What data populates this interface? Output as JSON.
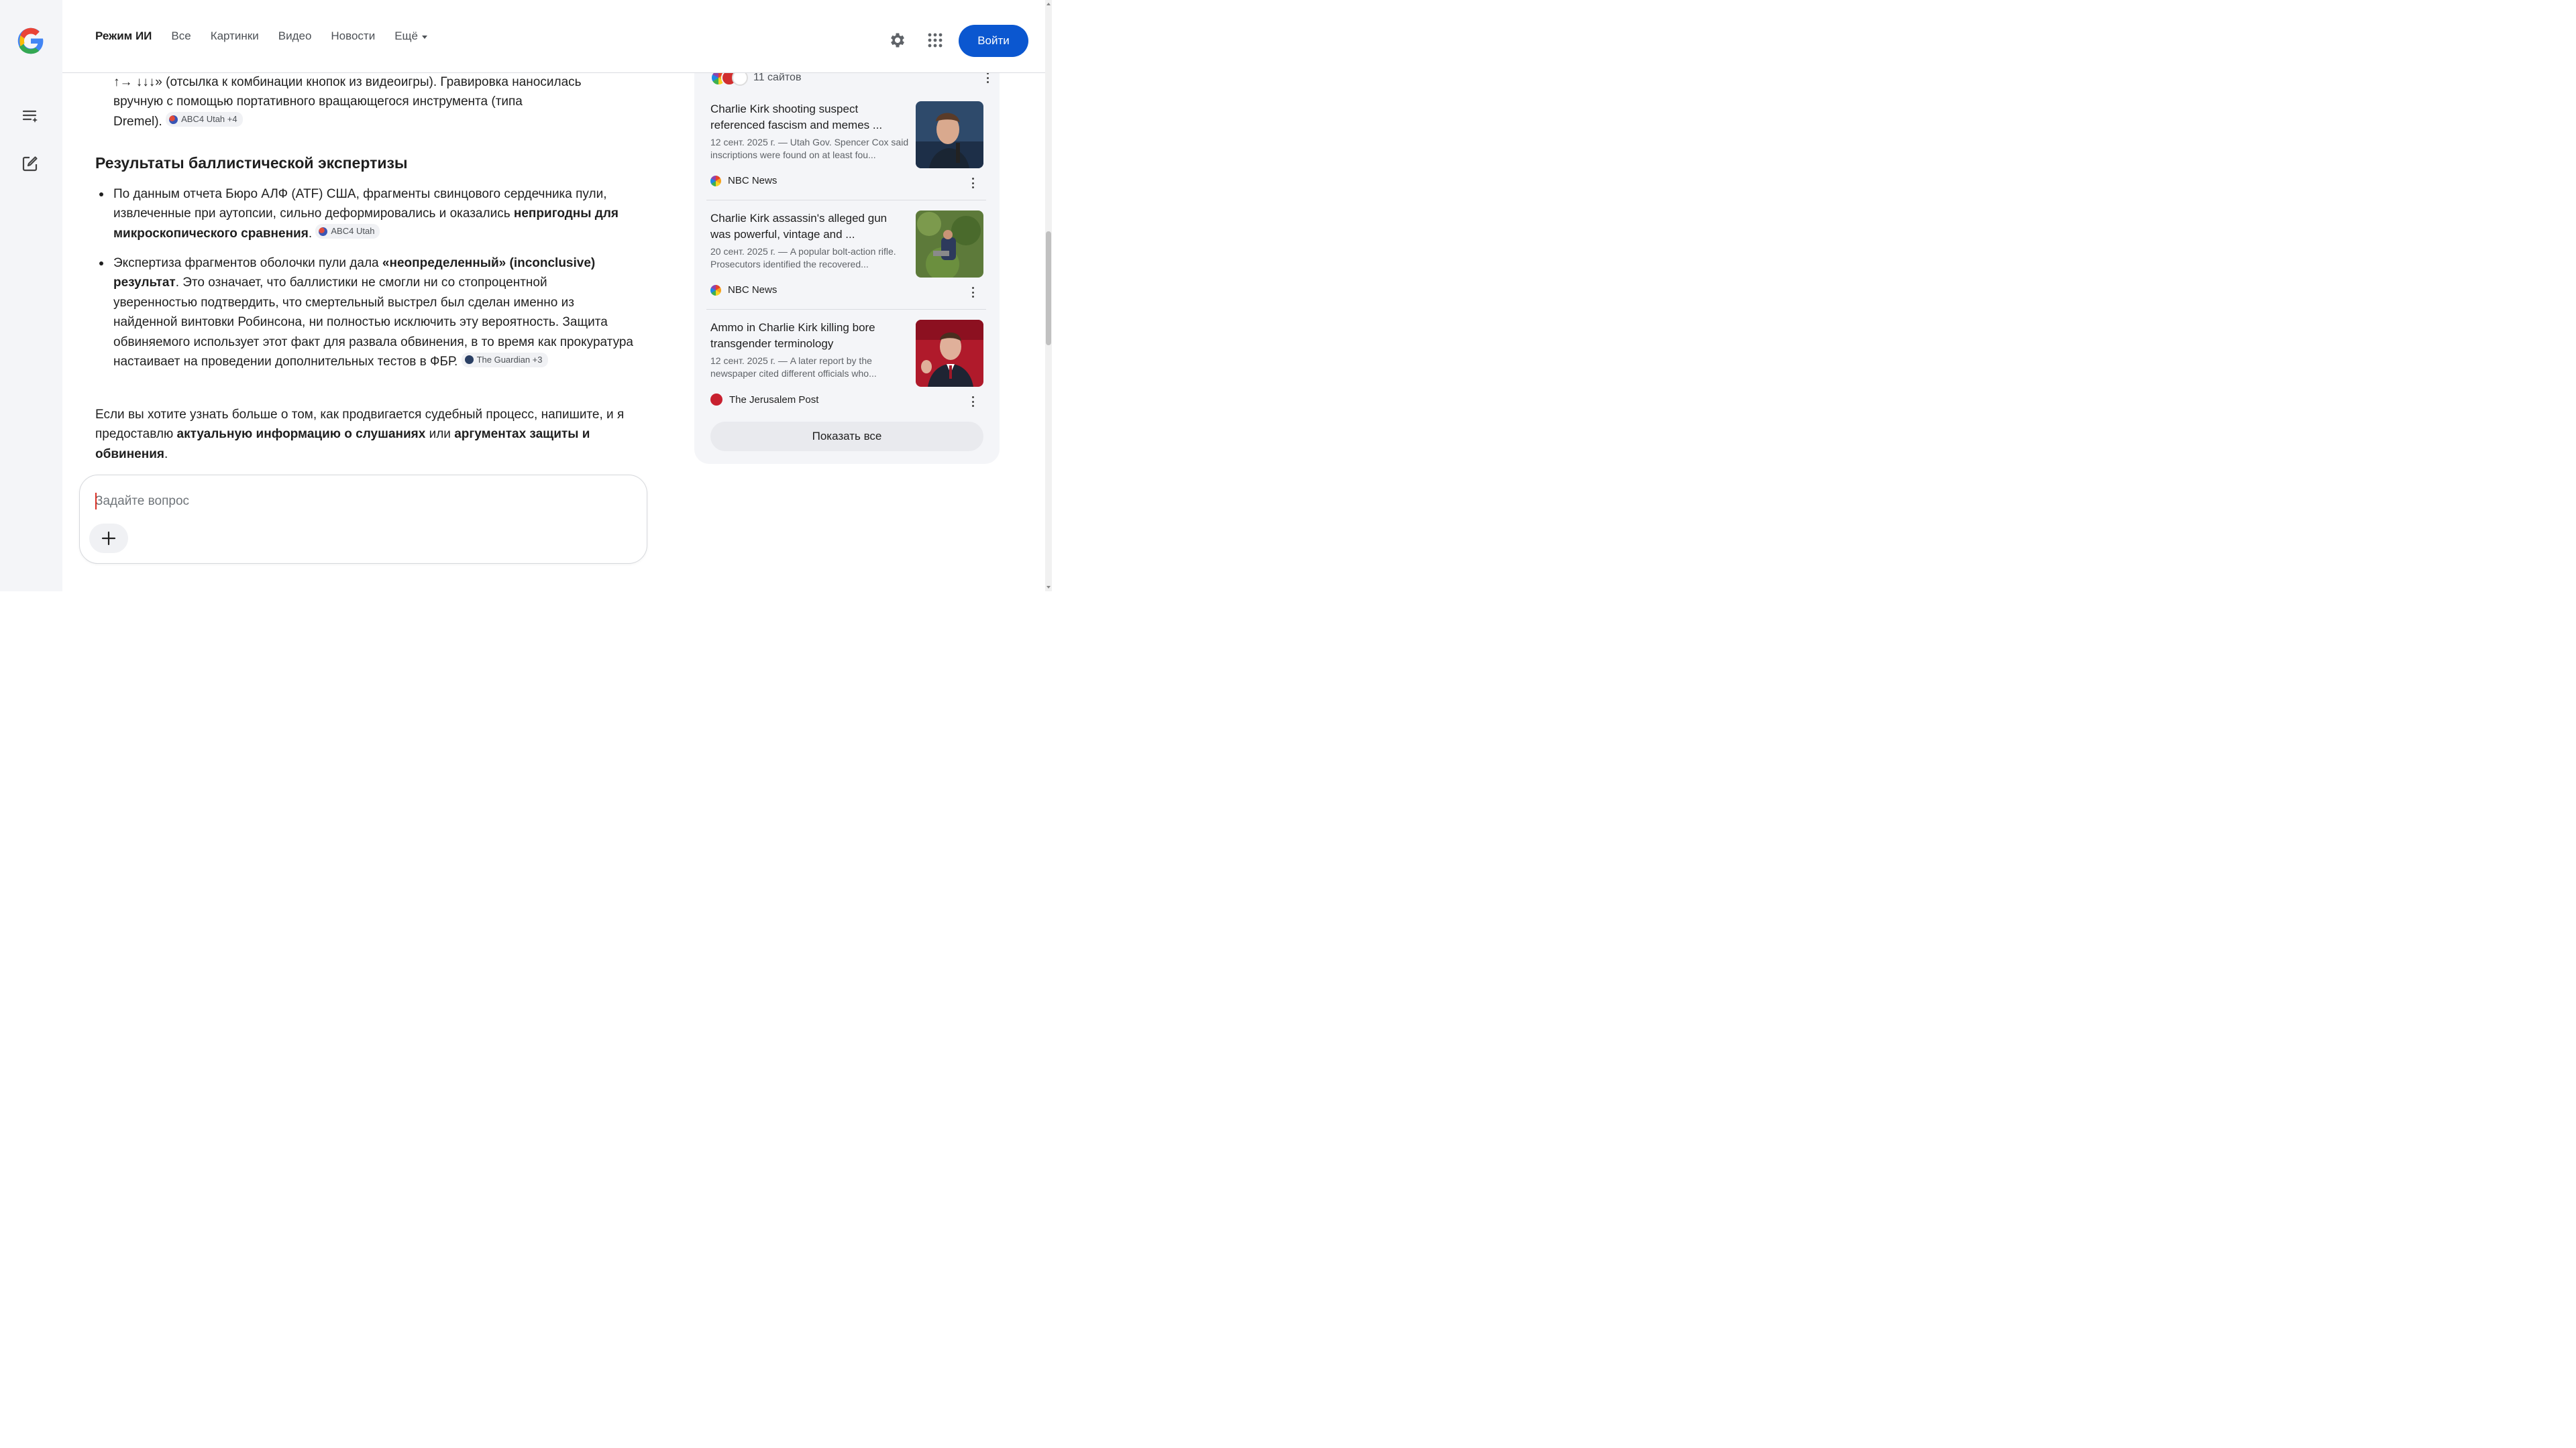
{
  "header": {
    "tabs": [
      "Режим ИИ",
      "Все",
      "Картинки",
      "Видео",
      "Новости",
      "Ещё"
    ],
    "signin_label": "Войти"
  },
  "rail": {
    "icons": [
      "google-logo",
      "history-icon",
      "new-chat-icon"
    ]
  },
  "answer": {
    "p1_line1": "↑→ ↓↓↓» (отсылка к комбинации кнопок из видеоигры). Гравировка наносилась",
    "p1_line2": "вручную с помощью портативного вращающегося инструмента (типа",
    "p1_line3": "Dremel).",
    "cite1": "ABC4 Utah +4",
    "heading": "Результаты баллистической экспертизы",
    "b1_pre": "По данным отчета Бюро АЛФ (ATF) США, фрагменты свинцового сердечника пули, извлеченные при аутопсии, сильно деформировались и оказались ",
    "b1_bold": "непригодны для микроскопического сравнения",
    "b1_post": ".",
    "cite2": "ABC4 Utah",
    "b2_pre": "Экспертиза фрагментов оболочки пули дала ",
    "b2_bold": "«неопределенный» (inconclusive) результат",
    "b2_post": ". Это означает, что баллистики не смогли ни со стопроцентной уверенностью подтвердить, что смертельный выстрел был сделан именно из найденной винтовки Робинсона, ни полностью исключить эту вероятность. Защита обвиняемого использует этот факт для развала обвинения, в то время как прокуратура настаивает на проведении дополнительных тестов в ФБР.",
    "cite3": "The Guardian +3",
    "p_end_pre": "Если вы хотите узнать больше о том, как продвигается судебный процесс, напишите, и я предоставлю ",
    "p_end_bold1": "актуальную информацию о слушаниях",
    "p_end_mid": " или ",
    "p_end_bold2": "аргументах защиты и обвинения",
    "p_end_post": "."
  },
  "ask": {
    "placeholder": "Задайте вопрос"
  },
  "sidebar": {
    "sites_count": "11 сайтов",
    "cards": [
      {
        "title": "Charlie Kirk shooting suspect referenced fascism and memes ...",
        "snippet": "12 сент. 2025 г. — Utah Gov. Spencer Cox said inscriptions were found on at least fou...",
        "source": "NBC News"
      },
      {
        "title": "Charlie Kirk assassin's alleged gun was powerful, vintage and ...",
        "snippet": "20 сент. 2025 г. — A popular bolt-action rifle. Prosecutors identified the recovered...",
        "source": "NBC News"
      },
      {
        "title": "Ammo in Charlie Kirk killing bore transgender terminology",
        "snippet": "12 сент. 2025 г. — A later report by the newspaper cited different officials who...",
        "source": "The Jerusalem Post"
      }
    ],
    "show_all_label": "Показать все"
  },
  "colors": {
    "accent": "#0b57d0",
    "rail_bg": "#f4f5f8",
    "text": "#1f1f1f"
  }
}
